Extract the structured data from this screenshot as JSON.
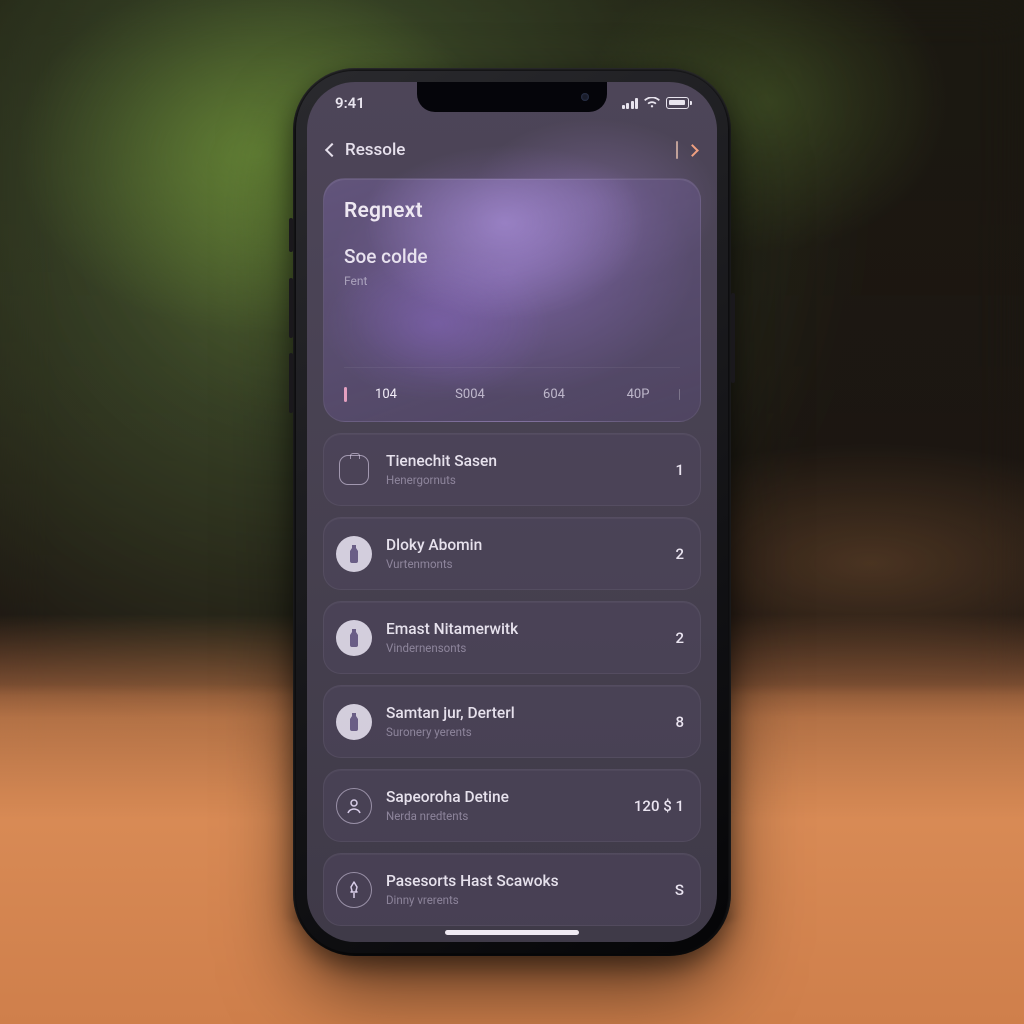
{
  "status": {
    "time": "9:41"
  },
  "nav": {
    "back_label": "Ressole"
  },
  "hero": {
    "title": "Regnext",
    "subtitle": "Soe colde",
    "subtext": "Fent",
    "segments": [
      "104",
      "S004",
      "604",
      "40P"
    ]
  },
  "list": [
    {
      "icon": "scan",
      "title": "Tienechit Sasen",
      "sub": "Henergornuts",
      "value": "1"
    },
    {
      "icon": "bottle",
      "title": "Dloky Abomin",
      "sub": "Vurtenmonts",
      "value": "2"
    },
    {
      "icon": "bottle",
      "title": "Emast Nitamerwitk",
      "sub": "Vindernensonts",
      "value": "2"
    },
    {
      "icon": "bottle",
      "title": "Samtan jur, Derterl",
      "sub": "Suronery yerents",
      "value": "8"
    },
    {
      "icon": "person",
      "title": "Sapeoroha Detine",
      "sub": "Nerda nredtents",
      "value": "120 $ 1"
    },
    {
      "icon": "pin",
      "title": "Pasesorts Hast Scawoks",
      "sub": "Dinny vrerents",
      "value": "S"
    }
  ]
}
